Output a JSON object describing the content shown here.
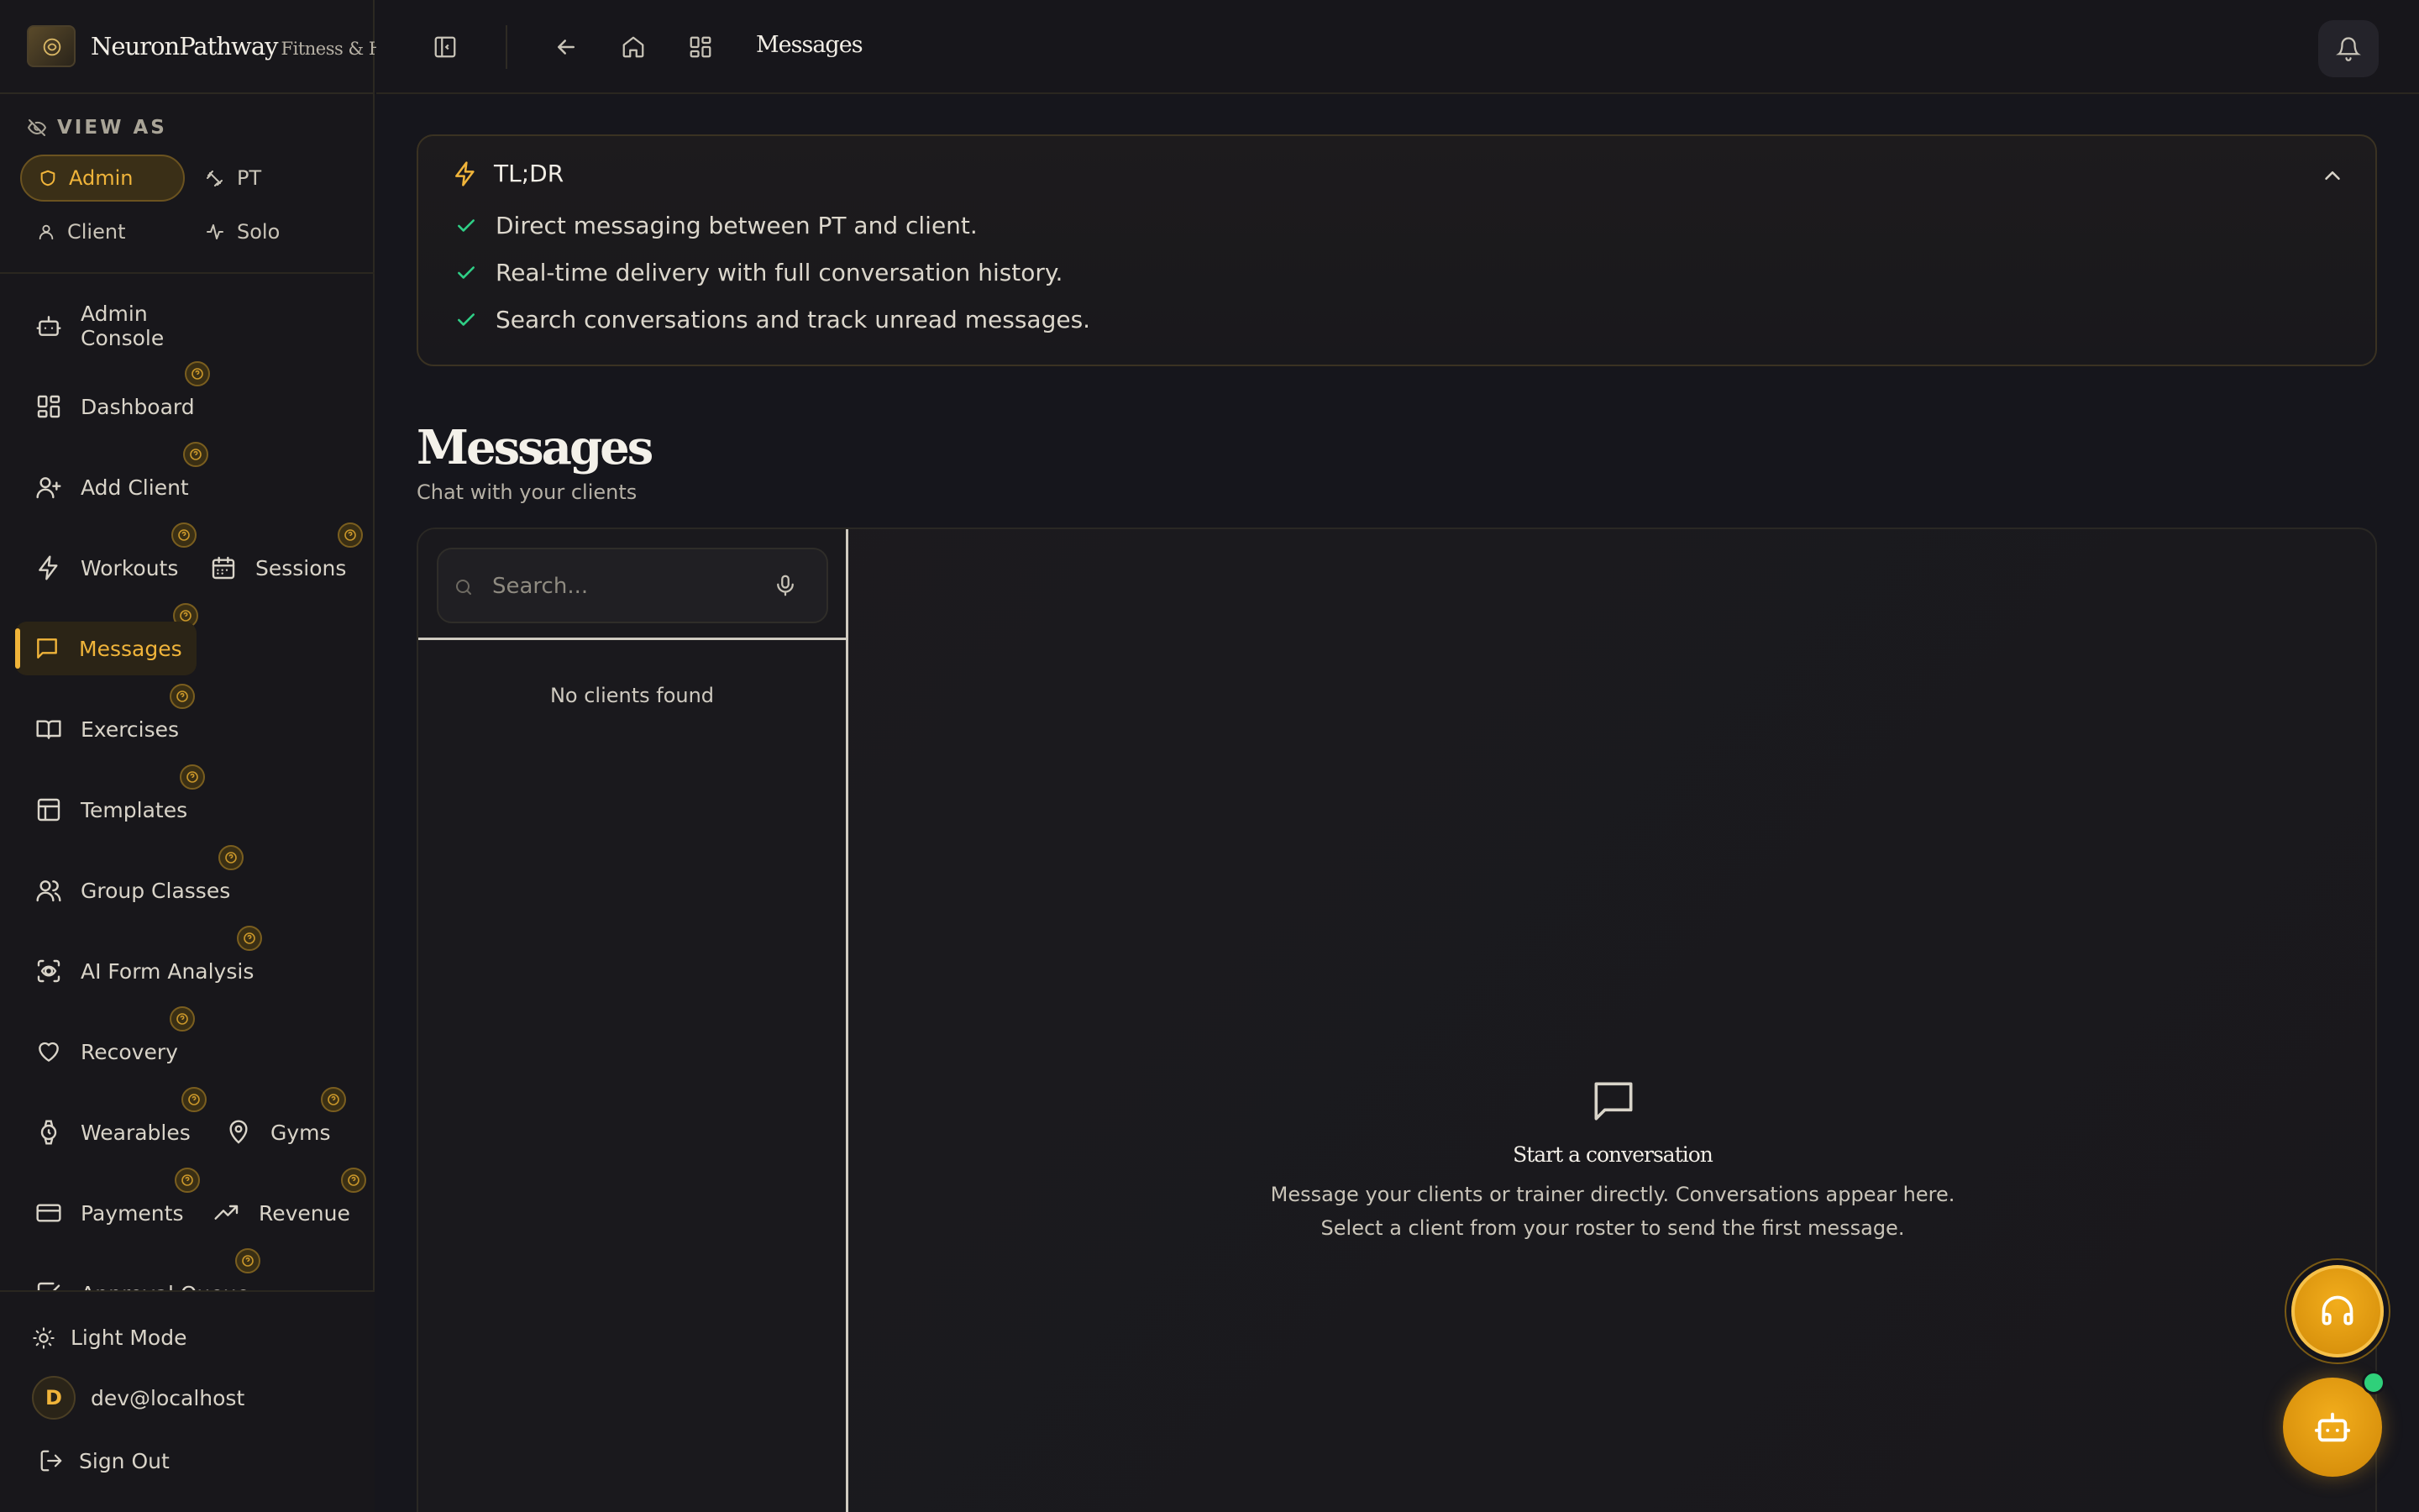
{
  "brand": {
    "name": "NeuronPathway",
    "tagline": "Fitness & Health"
  },
  "view_as": {
    "label": "VIEW AS",
    "roles": [
      {
        "label": "Admin",
        "active": true
      },
      {
        "label": "PT"
      },
      {
        "label": "Client"
      },
      {
        "label": "Solo"
      }
    ]
  },
  "nav": {
    "items": [
      {
        "label": "Admin Console",
        "icon": "bot-icon"
      },
      {
        "label": "Dashboard",
        "icon": "dashboard-icon"
      },
      {
        "label": "Add Client",
        "icon": "user-plus-icon"
      },
      {
        "label": "Workouts",
        "icon": "bolt-icon"
      },
      {
        "label": "Sessions",
        "icon": "calendar-icon"
      },
      {
        "label": "Messages",
        "icon": "message-icon",
        "active": true
      },
      {
        "label": "Exercises",
        "icon": "book-icon"
      },
      {
        "label": "Templates",
        "icon": "layout-icon"
      },
      {
        "label": "Group Classes",
        "icon": "users-icon"
      },
      {
        "label": "AI Form Analysis",
        "icon": "scan-eye-icon"
      },
      {
        "label": "Recovery",
        "icon": "heart-icon"
      },
      {
        "label": "Wearables",
        "icon": "watch-icon"
      },
      {
        "label": "Gyms",
        "icon": "map-pin-icon"
      },
      {
        "label": "Payments",
        "icon": "credit-card-icon"
      },
      {
        "label": "Revenue",
        "icon": "trending-up-icon"
      },
      {
        "label": "Approval Queue",
        "icon": "check-square-icon"
      }
    ]
  },
  "footer": {
    "theme_toggle": "Light Mode",
    "user_initial": "D",
    "user_email": "dev@localhost",
    "sign_out": "Sign Out"
  },
  "topbar": {
    "breadcrumb": "Messages"
  },
  "tldr": {
    "title": "TL;DR",
    "items": [
      "Direct messaging between PT and client.",
      "Real-time delivery with full conversation history.",
      "Search conversations and track unread messages."
    ]
  },
  "page": {
    "title": "Messages",
    "subtitle": "Chat with your clients"
  },
  "client_list": {
    "search_placeholder": "Search...",
    "empty_text": "No clients found"
  },
  "conversation": {
    "empty_title": "Start a conversation",
    "empty_line1": "Message your clients or trainer directly. Conversations appear here.",
    "empty_line2": "Select a client from your roster to send the first message."
  },
  "colors": {
    "accent": "#f0b43a",
    "background": "#16161c",
    "online": "#2fd07a"
  }
}
